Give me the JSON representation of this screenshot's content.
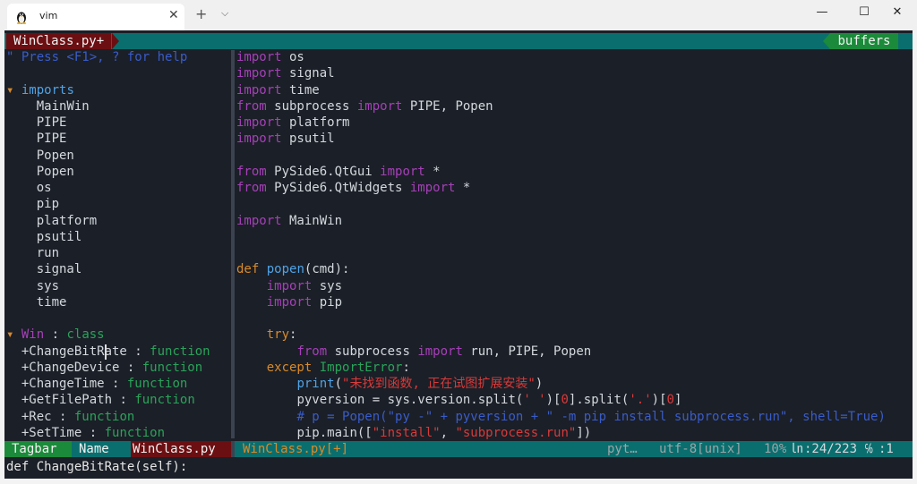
{
  "window": {
    "tab_title": "vim",
    "tab_close": "✕",
    "new_tab": "+",
    "dropdown": "⌵",
    "minimize": "—",
    "maximize": "☐",
    "close": "✕"
  },
  "tabline": {
    "buffer_label": "WinClass.py+",
    "buffers_label": "buffers"
  },
  "tagbar": {
    "help": "\" Press <F1>, ? for help",
    "sections": [
      {
        "marker": "▾",
        "name": "imports",
        "items": [
          "MainWin",
          "PIPE",
          "PIPE",
          "Popen",
          "Popen",
          "os",
          "pip",
          "platform",
          "psutil",
          "run",
          "signal",
          "sys",
          "time"
        ]
      },
      {
        "marker": "▾",
        "name": "Win",
        "sep": " : ",
        "kind": "class",
        "members": [
          {
            "name": "+ChangeBitRate",
            "kind": "function"
          },
          {
            "name": "+ChangeDevice",
            "kind": "function"
          },
          {
            "name": "+ChangeTime",
            "kind": "function"
          },
          {
            "name": "+GetFilePath",
            "kind": "function"
          },
          {
            "name": "+Rec",
            "kind": "function"
          },
          {
            "name": "+SetTime",
            "kind": "function"
          }
        ]
      }
    ]
  },
  "code": [
    [
      [
        "import",
        "kw"
      ],
      [
        " os",
        "id"
      ]
    ],
    [
      [
        "import",
        "kw"
      ],
      [
        " signal",
        "id"
      ]
    ],
    [
      [
        "import",
        "kw"
      ],
      [
        " time",
        "id"
      ]
    ],
    [
      [
        "from",
        "kw"
      ],
      [
        " subprocess ",
        "id"
      ],
      [
        "import",
        "kw"
      ],
      [
        " PIPE, Popen",
        "id"
      ]
    ],
    [
      [
        "import",
        "kw"
      ],
      [
        " platform",
        "id"
      ]
    ],
    [
      [
        "import",
        "kw"
      ],
      [
        " psutil",
        "id"
      ]
    ],
    [],
    [
      [
        "from",
        "kw"
      ],
      [
        " PySide6.QtGui ",
        "id"
      ],
      [
        "import",
        "kw"
      ],
      [
        " *",
        "id"
      ]
    ],
    [
      [
        "from",
        "kw"
      ],
      [
        " PySide6.QtWidgets ",
        "id"
      ],
      [
        "import",
        "kw"
      ],
      [
        " *",
        "id"
      ]
    ],
    [],
    [
      [
        "import",
        "kw"
      ],
      [
        " MainWin",
        "id"
      ]
    ],
    [],
    [],
    [
      [
        "def",
        "def"
      ],
      [
        " ",
        "id"
      ],
      [
        "popen",
        "fn"
      ],
      [
        "(cmd):",
        "id"
      ]
    ],
    [
      [
        "    ",
        "id"
      ],
      [
        "import",
        "kw"
      ],
      [
        " sys",
        "id"
      ]
    ],
    [
      [
        "    ",
        "id"
      ],
      [
        "import",
        "kw"
      ],
      [
        " pip",
        "id"
      ]
    ],
    [],
    [
      [
        "    ",
        "id"
      ],
      [
        "try",
        "def"
      ],
      [
        ":",
        "id"
      ]
    ],
    [
      [
        "        ",
        "id"
      ],
      [
        "from",
        "kw"
      ],
      [
        " subprocess ",
        "id"
      ],
      [
        "import",
        "kw"
      ],
      [
        " run, PIPE, Popen",
        "id"
      ]
    ],
    [
      [
        "    ",
        "id"
      ],
      [
        "except",
        "def"
      ],
      [
        " ",
        "id"
      ],
      [
        "ImportError",
        "exc"
      ],
      [
        ":",
        "id"
      ]
    ],
    [
      [
        "        ",
        "id"
      ],
      [
        "print",
        "fn"
      ],
      [
        "(",
        "id"
      ],
      [
        "\"未找到函数, 正在试图扩展安装\"",
        "str"
      ],
      [
        ")",
        "id"
      ]
    ],
    [
      [
        "        ",
        "id"
      ],
      [
        "pyversion = sys.version.split(",
        "id"
      ],
      [
        "' '",
        "str"
      ],
      [
        ")[",
        "id"
      ],
      [
        "0",
        "num"
      ],
      [
        "].split(",
        "id"
      ],
      [
        "'.'",
        "str"
      ],
      [
        ")[",
        "id"
      ],
      [
        "0",
        "num"
      ],
      [
        "]",
        "id"
      ]
    ],
    [
      [
        "        ",
        "id"
      ],
      [
        "# p = Popen(\"py -\" + pyversion + \" -m pip install subprocess.run\", shell=True)",
        "cmt"
      ]
    ],
    [
      [
        "        ",
        "id"
      ],
      [
        "pip.main([",
        "id"
      ],
      [
        "\"install\"",
        "str"
      ],
      [
        ", ",
        "id"
      ],
      [
        "\"subprocess.run\"",
        "str"
      ],
      [
        "])",
        "id"
      ]
    ]
  ],
  "status": {
    "tagbar": "Tagbar",
    "name": "Name",
    "file": "WinClass.py",
    "right_file": "WinClass.py[+]",
    "filetype": "pyt…",
    "encoding": "utf-8[unix]",
    "percent": "10%",
    "ln_icon": "㏑",
    "position": ":24/223",
    "col_icon": "℅",
    "col": ":1"
  },
  "cmdline": "def ChangeBitRate(self):",
  "colors": {
    "bg": "#1b1f27",
    "kw": "#a540b8",
    "id": "#d4d8de",
    "def": "#d88a2a",
    "fn": "#4fa3e6",
    "str": "#d83a3a",
    "num": "#d83a3a",
    "cmt": "#3a5cc8",
    "exc": "#2aa35a",
    "tag_section": "#4fa3e6",
    "tag_item": "#d4d8de",
    "tag_kind": "#2aa35a",
    "tag_class": "#a540b8",
    "tag_marker": "#d88a2a",
    "tag_help": "#3a5cc8"
  }
}
